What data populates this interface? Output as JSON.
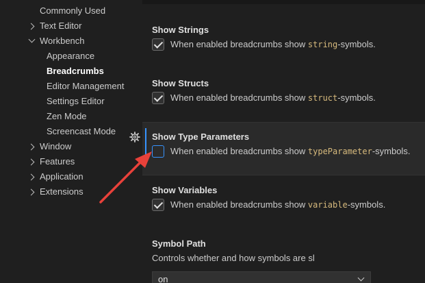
{
  "tree": {
    "commonly_used": "Commonly Used",
    "text_editor": "Text Editor",
    "workbench": "Workbench",
    "appearance": "Appearance",
    "breadcrumbs": "Breadcrumbs",
    "editor_management": "Editor Management",
    "settings_editor": "Settings Editor",
    "zen_mode": "Zen Mode",
    "screencast_mode": "Screencast Mode",
    "window": "Window",
    "features": "Features",
    "application": "Application",
    "extensions": "Extensions"
  },
  "settings": {
    "strings": {
      "title": "Show Strings",
      "pre": "When enabled breadcrumbs show ",
      "code": "string",
      "post": "-symbols.",
      "checked": true
    },
    "structs": {
      "title": "Show Structs",
      "pre": "When enabled breadcrumbs show ",
      "code": "struct",
      "post": "-symbols.",
      "checked": true
    },
    "type_parameters": {
      "title": "Show Type Parameters",
      "pre": "When enabled breadcrumbs show ",
      "code": "typeParameter",
      "post": "-symbols.",
      "checked": false
    },
    "variables": {
      "title": "Show Variables",
      "pre": "When enabled breadcrumbs show ",
      "code": "variable",
      "post": "-symbols.",
      "checked": true
    },
    "symbol_path": {
      "title": "Symbol Path",
      "desc": "Controls whether and how symbols are sl",
      "value": "on"
    }
  },
  "colors": {
    "background": "#1f1f1f",
    "focus_accent": "#3794ff",
    "code_text": "#d7ba7d",
    "annotation_arrow": "#e8413a"
  },
  "icons": {
    "gear": "gear-icon",
    "checkbox": "checkbox-icon",
    "chevron": "chevron-icon",
    "annotation": "red-arrow-annotation"
  }
}
